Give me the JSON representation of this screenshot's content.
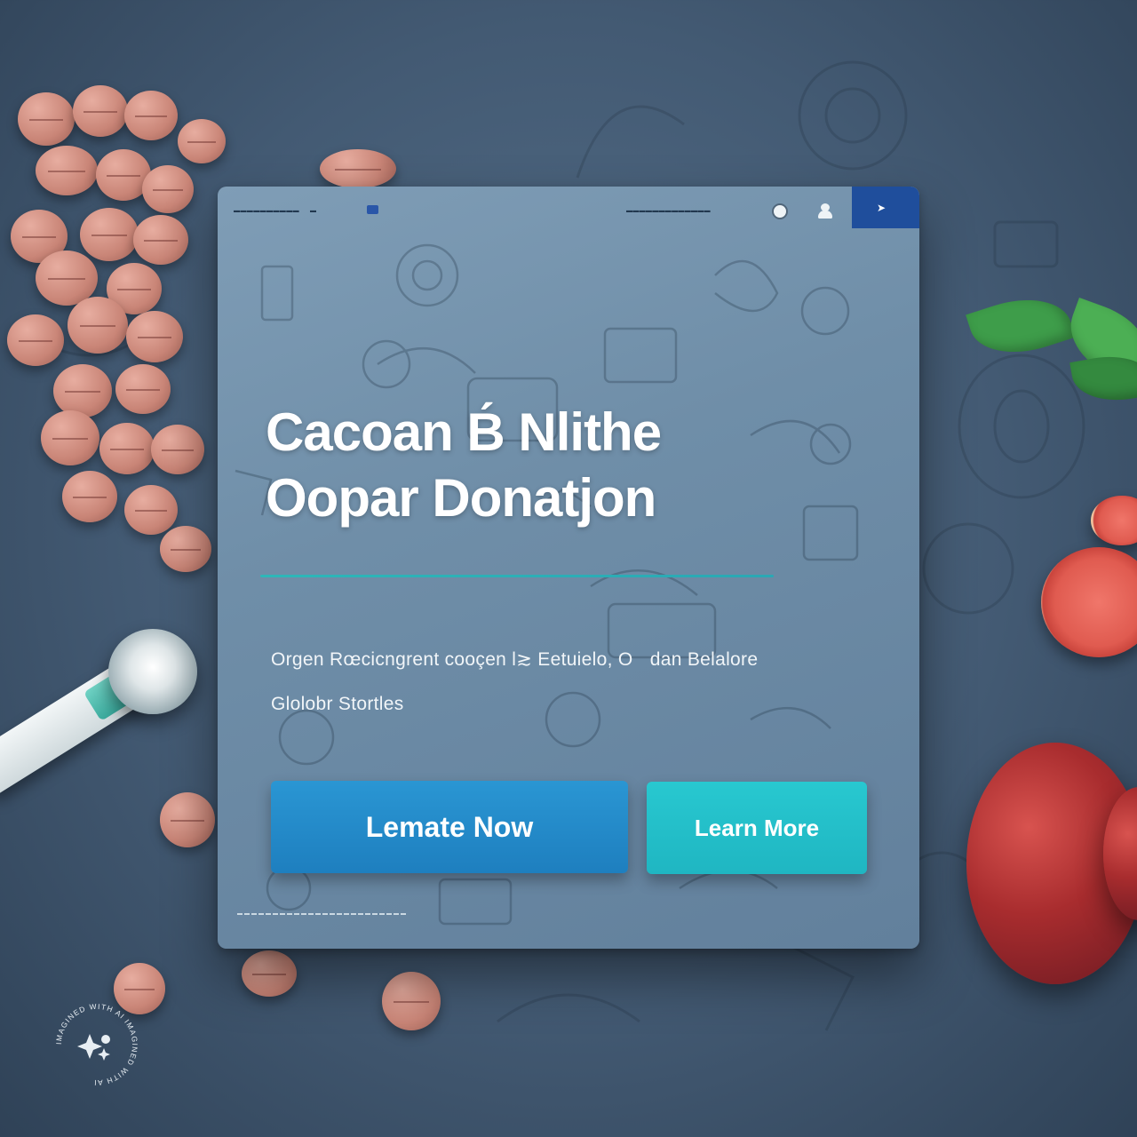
{
  "header": {
    "brand": "▬▬▬▬▬▬▬▬▬▬",
    "brand_mark": "▬",
    "nav_link": "▬▬▬▬▬▬▬▬▬▬▬▬▬"
  },
  "hero": {
    "headline_line1": "Cacoan B́ Nlithe",
    "headline_line2": "Oopar Donatjon",
    "subtitle_line1": "Orgen Rœcicngrent cooçen l≳ Eetuielo, Oﾠdan Belalore",
    "subtitle_line2": "Glolobr Stortles"
  },
  "actions": {
    "primary_label": "Lemate Now",
    "secondary_label": "Learn More"
  },
  "colors": {
    "primary": "#1e7fbf",
    "secondary": "#1fb6c2",
    "accent": "#2db7b8",
    "nav_corner": "#1f4e9c"
  },
  "icons": {
    "nav_circle": "circle-icon",
    "nav_user": "user-icon",
    "nav_arrow": "arrow-icon"
  },
  "watermark": {
    "text": "IMAGINED WITH AI IMAGINED WITH AI"
  }
}
